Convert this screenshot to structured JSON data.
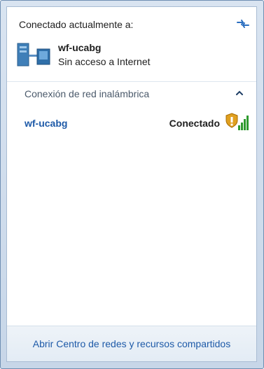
{
  "header": {
    "title": "Conectado actualmente a:"
  },
  "current_network": {
    "name": "wf-ucabg",
    "status": "Sin acceso a Internet",
    "icon": "network-computer-icon"
  },
  "wireless_group": {
    "label": "Conexión de red inalámbrica",
    "collapse_icon": "chevron-up-icon",
    "networks": [
      {
        "name": "wf-ucabg",
        "state": "Conectado",
        "signal_icon": "wifi-signal-warning-icon"
      }
    ]
  },
  "footer": {
    "link_label": "Abrir Centro de redes y recursos compartidos"
  },
  "colors": {
    "link": "#1e5aa8",
    "border": "#6f8fb3",
    "signal": "#2e9a2e",
    "warning": "#e0a020"
  }
}
